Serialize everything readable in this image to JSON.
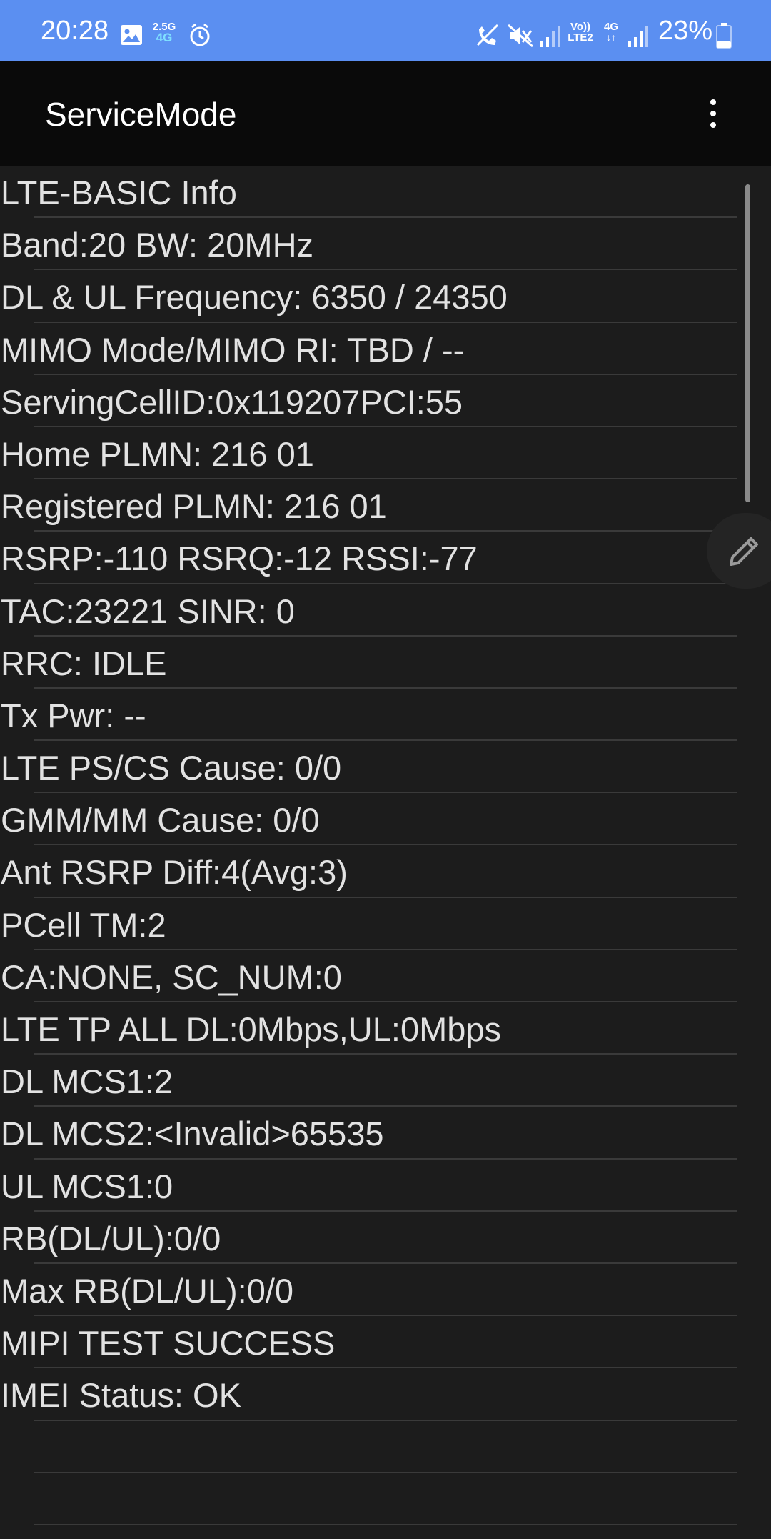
{
  "status_bar": {
    "time": "20:28",
    "net_type_top": "2.5G",
    "net_type_bottom": "4G",
    "volte_top": "Vo))",
    "volte_bottom": "LTE2",
    "data_type": "4G",
    "battery_percent": "23%"
  },
  "app_bar": {
    "title": "ServiceMode"
  },
  "rows": [
    "LTE-BASIC Info",
    "Band:20 BW: 20MHz",
    "DL & UL Frequency: 6350 / 24350",
    "MIMO Mode/MIMO RI: TBD / --",
    "ServingCellID:0x119207PCI:55",
    "Home PLMN: 216 01",
    "Registered PLMN: 216 01",
    "RSRP:-110 RSRQ:-12 RSSI:-77",
    "TAC:23221 SINR: 0",
    "RRC: IDLE",
    "Tx Pwr: --",
    "LTE PS/CS Cause: 0/0",
    "GMM/MM Cause: 0/0",
    "Ant RSRP Diff:4(Avg:3)",
    "PCell TM:2",
    "CA:NONE, SC_NUM:0",
    "LTE TP ALL DL:0Mbps,UL:0Mbps",
    "DL MCS1:2",
    "DL MCS2:<Invalid>65535",
    "UL MCS1:0",
    "RB(DL/UL):0/0",
    "Max RB(DL/UL):0/0",
    "MIPI TEST SUCCESS",
    "IMEI Status: OK",
    "",
    ""
  ],
  "icons": {
    "gallery": "image-icon",
    "alarm": "alarm-clock-icon",
    "no_call": "blocked-call-icon",
    "mute": "mute-icon",
    "signal1": "signal-icon",
    "signal2": "signal-icon",
    "battery": "battery-icon",
    "menu": "more-vert-icon",
    "edit": "pencil-icon"
  }
}
